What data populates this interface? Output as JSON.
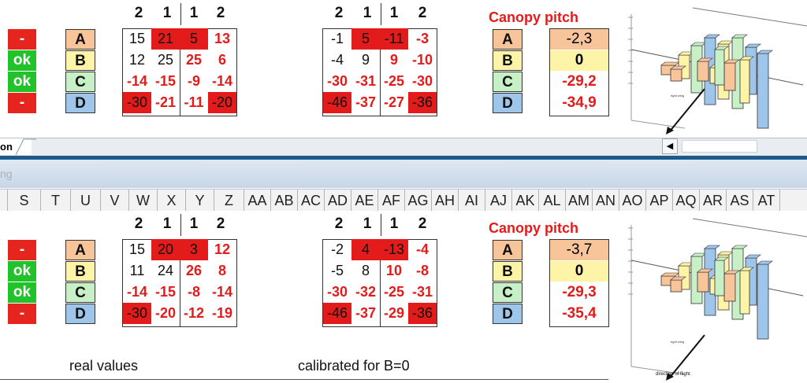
{
  "col_headers": [
    "S",
    "T",
    "U",
    "V",
    "W",
    "X",
    "Y",
    "Z",
    "AA",
    "AB",
    "AC",
    "AD",
    "AE",
    "AF",
    "AG",
    "AH",
    "AI",
    "AJ",
    "AK",
    "AL",
    "AM",
    "AN",
    "AO",
    "AP",
    "AQ",
    "AR",
    "AS",
    "AT"
  ],
  "sheet_tab_label": "on",
  "second_window_title": "ng",
  "group_headers": [
    "2",
    "1",
    "1",
    "2"
  ],
  "row_labels": [
    "A",
    "B",
    "C",
    "D"
  ],
  "top": {
    "status": [
      "-",
      "ok",
      "ok",
      "-"
    ],
    "raw": [
      [
        "15",
        "21",
        "5",
        "13"
      ],
      [
        "12",
        "25",
        "25",
        "6"
      ],
      [
        "-14",
        "-15",
        "-9",
        "-14"
      ],
      [
        "-30",
        "-21",
        "-11",
        "-20"
      ]
    ],
    "calibrated": [
      [
        "-1",
        "5",
        "-11",
        "-3"
      ],
      [
        "-4",
        "9",
        "9",
        "-10"
      ],
      [
        "-30",
        "-31",
        "-25",
        "-30"
      ],
      [
        "-46",
        "-37",
        "-27",
        "-36"
      ]
    ],
    "pitch_title": "Canopy pitch",
    "pitch_values": [
      "-2,3",
      "0",
      "-29,2",
      "-34,9"
    ]
  },
  "bottom": {
    "status": [
      "-",
      "ok",
      "ok",
      "-"
    ],
    "raw": [
      [
        "15",
        "20",
        "3",
        "12"
      ],
      [
        "11",
        "24",
        "26",
        "8"
      ],
      [
        "-14",
        "-15",
        "-8",
        "-14"
      ],
      [
        "-30",
        "-20",
        "-12",
        "-19"
      ]
    ],
    "calibrated": [
      [
        "-2",
        "4",
        "-13",
        "-4"
      ],
      [
        "-5",
        "8",
        "10",
        "-8"
      ],
      [
        "-30",
        "-32",
        "-25",
        "-31"
      ],
      [
        "-46",
        "-37",
        "-29",
        "-36"
      ]
    ],
    "pitch_title": "Canopy pitch",
    "pitch_values": [
      "-3,7",
      "0",
      "-29,3",
      "-35,4"
    ]
  },
  "footer": {
    "left": "real values",
    "right": "calibrated for B=0"
  },
  "chart_labels": {
    "axis": "direction of flight"
  },
  "colors": {
    "red": "#e31b1b",
    "green": "#22c22a",
    "A": "#f8c49a",
    "B": "#fdf4a8",
    "C": "#c8f0c6",
    "D": "#9ec5ea"
  }
}
